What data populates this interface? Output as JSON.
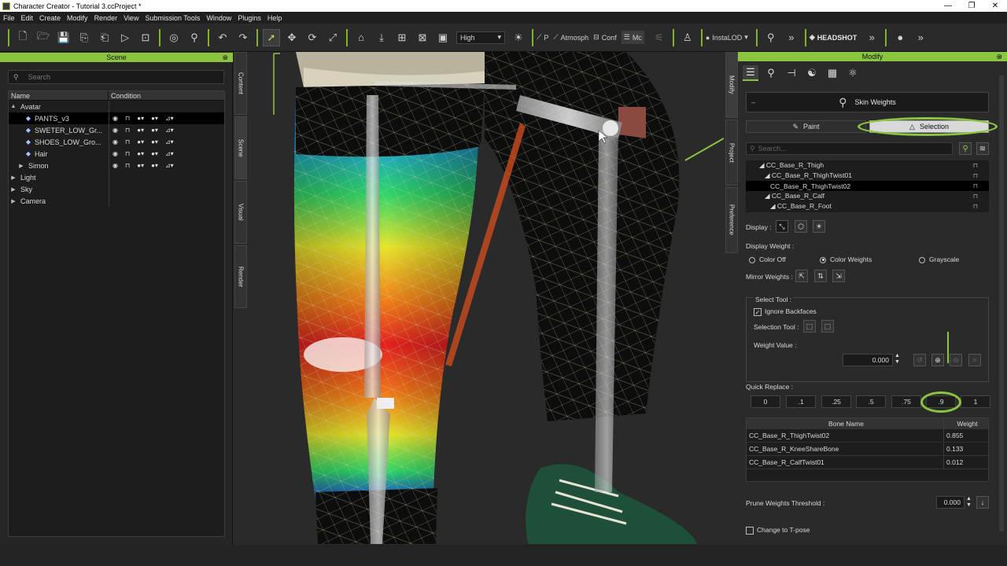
{
  "window": {
    "title": "Character Creator - Tutorial 3.ccProject *"
  },
  "menu": [
    "File",
    "Edit",
    "Create",
    "Modify",
    "Render",
    "View",
    "Submission Tools",
    "Window",
    "Plugins",
    "Help"
  ],
  "toolbar": {
    "quality": "High",
    "labels": [
      "P",
      "Atmosph",
      "Conf",
      "Mc"
    ],
    "instalod": "InstaLOD",
    "headshot": "HEADSHOT"
  },
  "scene": {
    "header": "Scene",
    "search_placeholder": "Search",
    "col_name": "Name",
    "col_condition": "Condition",
    "items": [
      {
        "label": "Avatar",
        "arrow": "▲",
        "indent": 0
      },
      {
        "label": "PANTS_v3",
        "indent": 2,
        "selected": true
      },
      {
        "label": "SWETER_LOW_Gr...",
        "indent": 2
      },
      {
        "label": "SHOES_LOW_Gro...",
        "indent": 2
      },
      {
        "label": "Hair",
        "indent": 2
      },
      {
        "label": "Simon",
        "arrow": "▶",
        "indent": 1
      },
      {
        "label": "Light",
        "arrow": "▶",
        "indent": 0
      },
      {
        "label": "Sky",
        "arrow": "▶",
        "indent": 0
      },
      {
        "label": "Camera",
        "arrow": "▶",
        "indent": 0
      }
    ]
  },
  "left_tabs": [
    "Content",
    "Scene",
    "Visual",
    "Render"
  ],
  "right_tabs": [
    "Modify",
    "Project",
    "Preference"
  ],
  "modify": {
    "header": "Modify",
    "skin_weights": "Skin Weights",
    "paint": "Paint",
    "selection": "Selection",
    "search_placeholder": "Search...",
    "bones": [
      {
        "label": "◢ CC_Base_R_Thigh",
        "indent": 1
      },
      {
        "label": "◢ CC_Base_R_ThighTwist01",
        "indent": 2
      },
      {
        "label": "CC_Base_R_ThighTwist02",
        "indent": 3,
        "selected": true
      },
      {
        "label": "◢ CC_Base_R_Calf",
        "indent": 2
      },
      {
        "label": "◢ CC_Base_R_Foot",
        "indent": 3
      }
    ],
    "display_label": "Display :",
    "display_weight_label": "Display Weight :",
    "color_off": "Color Off",
    "color_weights": "Color Weights",
    "grayscale": "Grayscale",
    "mirror_weights": "Mirror Weights :",
    "select_tool_group": "Select Tool :",
    "ignore_backfaces": "Ignore Backfaces",
    "selection_tool": "Selection Tool :",
    "weight_value_label": "Weight Value :",
    "weight_value": "0.000",
    "quick_replace_label": "Quick Replace :",
    "quick_replace": [
      "0",
      ".1",
      ".25",
      ".5",
      ".75",
      ".9",
      "1"
    ],
    "table_headers": [
      "Bone Name",
      "Weight"
    ],
    "weights": [
      {
        "bone": "CC_Base_R_ThighTwist02",
        "weight": "0.855"
      },
      {
        "bone": "CC_Base_R_KneeShareBone",
        "weight": "0.133"
      },
      {
        "bone": "CC_Base_R_CalfTwist01",
        "weight": "0.012"
      }
    ],
    "prune_label": "Prune Weights Threshold :",
    "prune_value": "0.000",
    "tpose": "Change to T-pose"
  },
  "colors": {
    "accent": "#8bc53f",
    "panel": "#2a2a2a",
    "selected_row": "#000000"
  },
  "icons": [
    "new-file-icon",
    "open-folder-icon",
    "save-icon",
    "undo-icon",
    "redo-icon",
    "select-arrow-icon",
    "move-icon",
    "rotate-icon",
    "scale-icon",
    "home-icon",
    "sun-icon",
    "search-icon",
    "lock-icon",
    "close-icon"
  ]
}
